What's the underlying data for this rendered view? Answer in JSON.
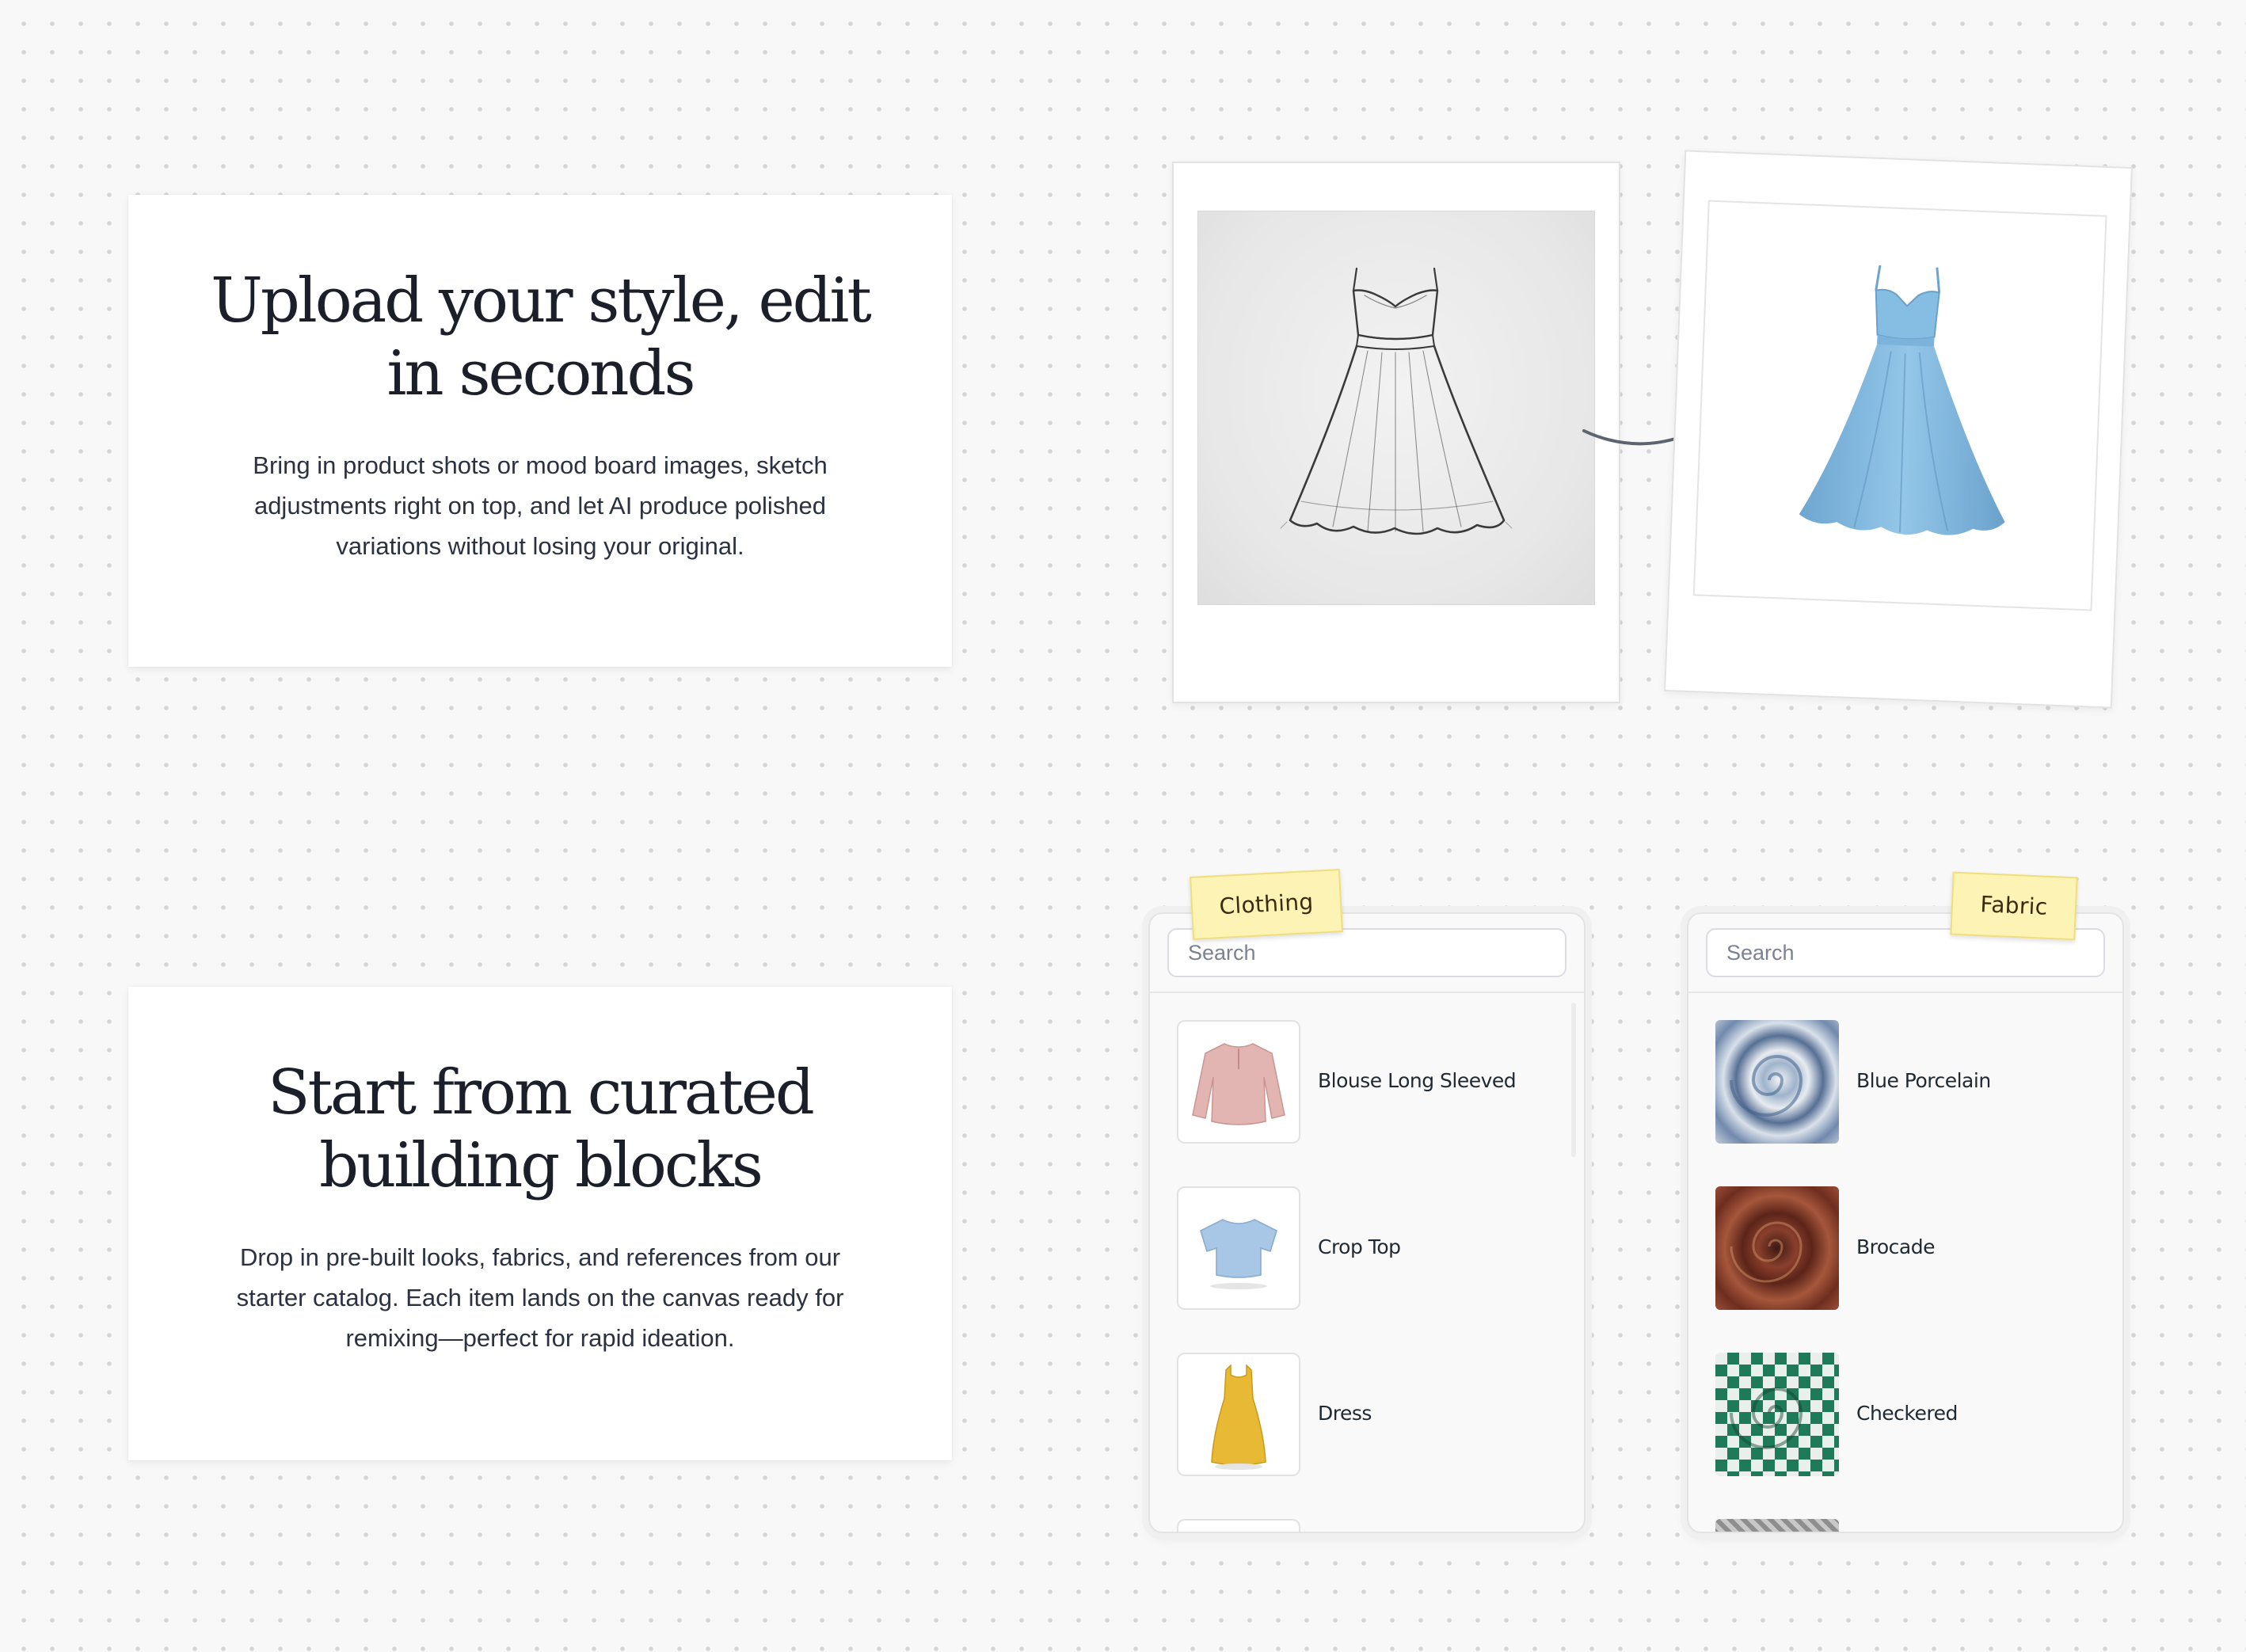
{
  "sections": [
    {
      "title_line1": "Upload your style, edit",
      "title_line2": "in seconds",
      "body_line1": "Bring in product shots or mood board images, sketch",
      "body_line2": "adjustments right on top, and let AI produce polished",
      "body_line3": "variations without losing your original."
    },
    {
      "title_line1": "Start from curated",
      "title_line2": "building blocks",
      "body_line1": "Drop in pre-built looks, fabrics, and references from our",
      "body_line2": "starter catalog. Each item lands on the canvas ready for",
      "body_line3": "remixing—perfect for rapid ideation."
    }
  ],
  "clothing_panel": {
    "tag": "Clothing",
    "search_placeholder": "Search",
    "items": [
      {
        "label": "Blouse Long Sleeved"
      },
      {
        "label": "Crop Top"
      },
      {
        "label": "Dress"
      }
    ]
  },
  "fabric_panel": {
    "tag": "Fabric",
    "search_placeholder": "Search",
    "items": [
      {
        "label": "Blue Porcelain"
      },
      {
        "label": "Brocade"
      },
      {
        "label": "Checkered"
      }
    ]
  },
  "colors": {
    "canvas": "#f8f8f8",
    "tag_yellow": "#fdf3b4",
    "dress_blue": "#8fc1e4",
    "brocade": "#7a3328",
    "checkered": "#1f7a5a"
  },
  "icons": [
    "sketch-dress-image",
    "blue-dress-image",
    "curved-arrow-icon"
  ]
}
